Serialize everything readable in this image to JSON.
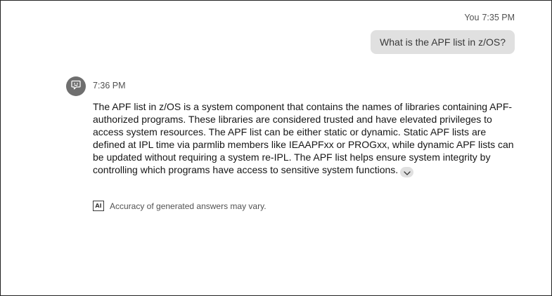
{
  "user_message": {
    "sender": "You",
    "time": "7:35 PM",
    "text": "What is the APF list in z/OS?"
  },
  "assistant_message": {
    "avatar_icon": "chat-bot-icon",
    "time": "7:36 PM",
    "text": "The APF list in z/OS is a system component that contains the names of libraries containing APF-authorized programs. These libraries are considered trusted and have elevated privileges to access system resources. The APF list can be either static or dynamic. Static APF lists are defined at IPL time via parmlib members like IEAAPFxx or PROGxx, while dynamic APF lists can be updated without requiring a system re-IPL. The APF list helps ensure system integrity by controlling which programs have access to sensitive system functions.",
    "expand_icon": "chevron-down-icon"
  },
  "disclaimer": {
    "badge": "AI",
    "text": "Accuracy of generated answers may vary."
  },
  "colors": {
    "bubble": "#e0e0e0",
    "avatar": "#6f6f6f",
    "text": "#161616",
    "muted": "#525252"
  }
}
